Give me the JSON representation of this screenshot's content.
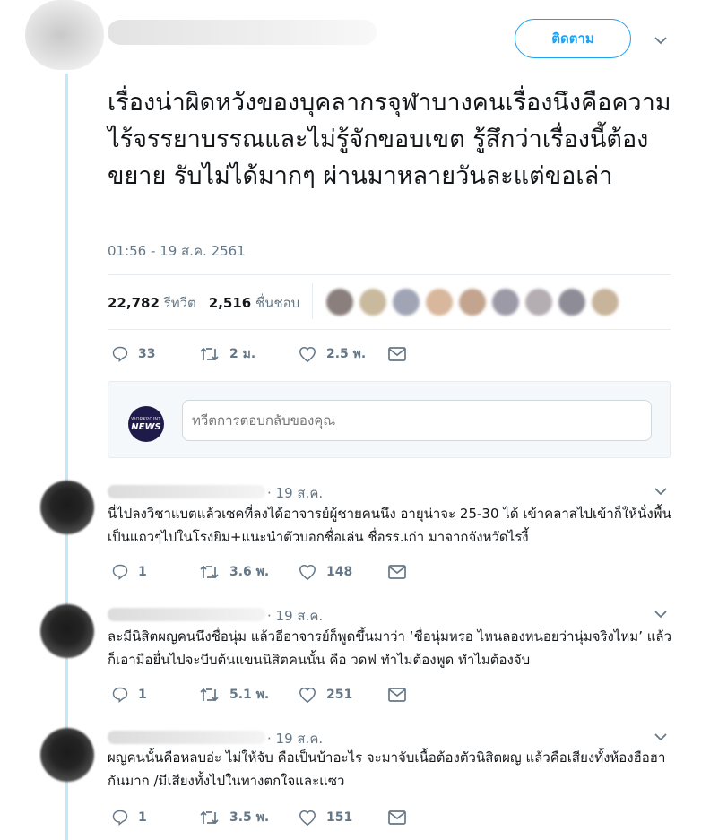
{
  "header": {
    "follow_label": "ติดตาม"
  },
  "tweet": {
    "text": "เรื่องน่าผิดหวังของบุคลากรจุฬาบางคนเรื่องนึงคือความไร้จรรยาบรรณและไม่รู้จักขอบเขต รู้สึกว่าเรื่องนี้ต้องขยาย รับไม่ได้มากๆ ผ่านมาหลายวันละแต่ขอเล่า",
    "timestamp": "01:56 - 19 ส.ค. 2561",
    "retweet_count": "22,782",
    "retweet_label": "รีทวีต",
    "like_count": "2,516",
    "like_label": "ชื่นชอบ",
    "actions": {
      "replies": "33",
      "retweets": "2 ม.",
      "likes": "2.5 พ."
    }
  },
  "reply_box": {
    "avatar_top": "WORKPOINT",
    "avatar_main": "NEWS",
    "placeholder": "ทวีตการตอบกลับของคุณ"
  },
  "replies": [
    {
      "date": "· 19 ส.ค.",
      "text": "นี่ไปลงวิชาแบตแล้วเซคที่ลงได้อาจารย์ผู้ชายคนนึง อายุน่าจะ 25-30 ได้ เข้าคลาสไปเข้าก็ให้นั่งพื้นเป็นแถวๆไปในโรงยิม+แนะนำตัวบอกชื่อเล่น ชื่อรร.เก่า มาจากจังหวัดไรงี้",
      "replies": "1",
      "retweets": "3.6 พ.",
      "likes": "148"
    },
    {
      "date": "· 19 ส.ค.",
      "text": "ละมีนิสิตผญคนนึงชื่อนุ่ม แล้วอีอาจารย์ก็พูดขึ้นมาว่า ‘ชื่อนุ่มหรอ ไหนลองหน่อยว่านุ่มจริงไหม’ แล้วก็เอามือยื่นไปจะบีบต้นแขนนิสิตคนนั้น คือ วดฟ ทำไมต้องพูด ทำไมต้องจับ",
      "replies": "1",
      "retweets": "5.1 พ.",
      "likes": "251"
    },
    {
      "date": "· 19 ส.ค.",
      "text": "ผญคนนั้นคือหลบอ่ะ ไม่ให้จับ คือเป็นบ้าอะไร จะมาจับเนื้อต้องตัวนิสิตผญ แล้วคือเสียงทั้งห้องฮือฮากันมาก /มีเสียงทั้งไปในทางตกใจและแซว",
      "replies": "1",
      "retweets": "3.5 พ.",
      "likes": "151"
    }
  ],
  "colors": {
    "accent": "#1da1f2",
    "secondary_text": "#657786",
    "thread_line": "#c4e7f9",
    "divider": "#e6ecf0"
  },
  "icons": [
    "chevron-down-icon",
    "reply-icon",
    "retweet-icon",
    "like-icon",
    "message-icon"
  ]
}
